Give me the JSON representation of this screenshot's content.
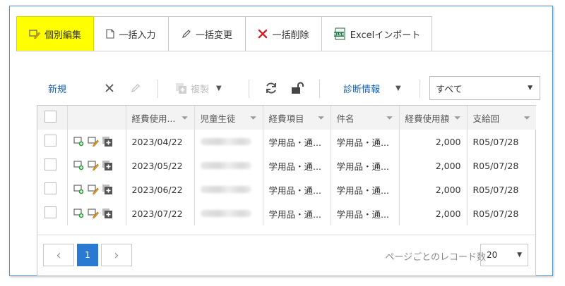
{
  "tabs": [
    {
      "label": "個別編集",
      "icon": "edit-icon"
    },
    {
      "label": "一括入力",
      "icon": "document-icon"
    },
    {
      "label": "一括変更",
      "icon": "pencil-icon"
    },
    {
      "label": "一括削除",
      "icon": "delete-x-icon"
    },
    {
      "label": "Excelインポート",
      "icon": "excel-xlsx-icon"
    }
  ],
  "toolbar": {
    "new_label": "新規",
    "copy_label": "複製",
    "diagnostic_label": "診断情報",
    "filter_select_value": "すべて"
  },
  "columns": [
    "",
    "",
    "経費使用...",
    "児童生徒",
    "経費項目",
    "件名",
    "経費使用額",
    "支給回"
  ],
  "rows": [
    {
      "date": "2023/04/22",
      "student": "",
      "item": "学用品・通...",
      "subject": "学用品・通...",
      "amount": "2,000",
      "round": "R05/07/28"
    },
    {
      "date": "2023/05/22",
      "student": "",
      "item": "学用品・通...",
      "subject": "学用品・通...",
      "amount": "2,000",
      "round": "R05/07/28"
    },
    {
      "date": "2023/06/22",
      "student": "",
      "item": "学用品・通...",
      "subject": "学用品・通...",
      "amount": "2,000",
      "round": "R05/07/28"
    },
    {
      "date": "2023/07/22",
      "student": "",
      "item": "学用品・通...",
      "subject": "学用品・通...",
      "amount": "2,000",
      "round": "R05/07/28"
    }
  ],
  "pager": {
    "current_page": "1",
    "per_page_label": "ページごとのレコード数",
    "per_page_value": "20"
  },
  "colors": {
    "active_tab": "#ffff00",
    "accent": "#2a7ad2",
    "link": "#1a5fb4"
  }
}
